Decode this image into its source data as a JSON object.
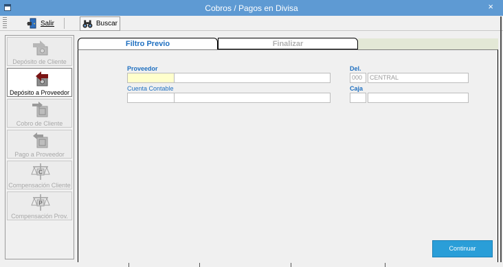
{
  "window": {
    "title": "Cobros / Pagos en Divisa",
    "close_glyph": "×"
  },
  "toolbar": {
    "exit_label": "Salir",
    "exit_icon": "exit-door-icon",
    "search_label": "Buscar",
    "search_icon": "binoculars-icon"
  },
  "nav": {
    "items": [
      {
        "label": "Depósito de Cliente",
        "icon": "deposit-client-icon",
        "active": false
      },
      {
        "label": "Depósito a Proveedor",
        "icon": "deposit-supplier-icon",
        "active": true
      },
      {
        "label": "Cobro de Cliente",
        "icon": "safe-in-icon",
        "active": false
      },
      {
        "label": "Pago a Proveedor",
        "icon": "safe-out-icon",
        "active": false
      },
      {
        "label": "Compensación Cliente",
        "icon": "scale-c-icon",
        "active": false
      },
      {
        "label": "Compensación Prov.",
        "icon": "scale-p-icon",
        "active": false
      }
    ]
  },
  "tabs": [
    {
      "label": "Filtro Previo",
      "active": true
    },
    {
      "label": "Finalizar",
      "active": false
    }
  ],
  "form": {
    "proveedor_label": "Proveedor",
    "proveedor_code": "",
    "proveedor_name": "",
    "cuenta_label": "Cuenta Contable",
    "cuenta_code": "",
    "cuenta_name": "",
    "del_label": "Del.",
    "del_code": "000",
    "del_name": "CENTRAL",
    "caja_label": "Caja",
    "caja_code": "",
    "caja_name": ""
  },
  "actions": {
    "continue_label": "Continuar"
  },
  "colors": {
    "titlebar": "#5e9ad3",
    "accent_blue": "#1e6fc0",
    "button": "#2a9ed8",
    "highlight_field": "#ffffcc"
  }
}
